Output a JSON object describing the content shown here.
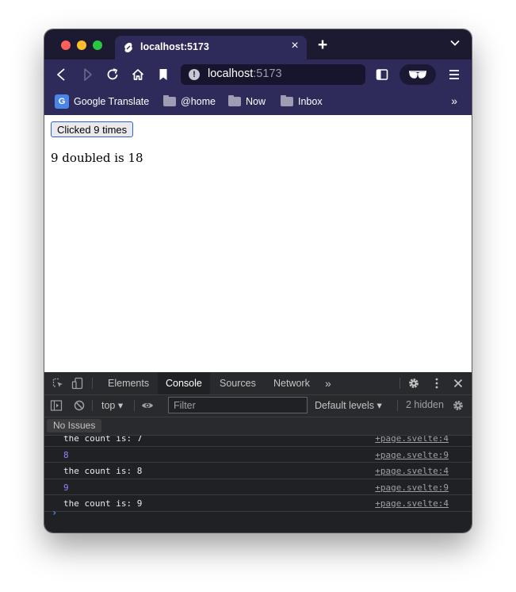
{
  "browser": {
    "tab_title": "localhost:5173",
    "url_host": "localhost",
    "url_port": ":5173",
    "new_tab_label": "+",
    "tab_close_label": "×"
  },
  "bookmarks": [
    {
      "label": "Google Translate",
      "icon": "google-translate-icon"
    },
    {
      "label": "@home",
      "icon": "folder-icon"
    },
    {
      "label": "Now",
      "icon": "folder-icon"
    },
    {
      "label": "Inbox",
      "icon": "folder-icon"
    }
  ],
  "bookmarks_more": "»",
  "page": {
    "button_label": "Clicked 9 times",
    "text": "9 doubled is 18"
  },
  "devtools": {
    "tabs": [
      "Elements",
      "Console",
      "Sources",
      "Network"
    ],
    "active_tab": "Console",
    "more_tabs": "»",
    "context": "top",
    "filter_placeholder": "Filter",
    "levels": "Default levels",
    "hidden_count": "2 hidden",
    "issues_label": "No Issues",
    "console_rows": [
      {
        "message": "the count is: 7",
        "source": "+page.svelte:4",
        "kind": "text"
      },
      {
        "message": "8",
        "source": "+page.svelte:9",
        "kind": "number"
      },
      {
        "message": "the count is: 8",
        "source": "+page.svelte:4",
        "kind": "text"
      },
      {
        "message": "9",
        "source": "+page.svelte:9",
        "kind": "number"
      },
      {
        "message": "the count is: 9",
        "source": "+page.svelte:4",
        "kind": "text"
      }
    ],
    "prompt": "›"
  },
  "colors": {
    "tabstrip": "#1b1a30",
    "toolbar": "#2e2a5a",
    "devtools_bg": "#202124",
    "number_log": "#9980ff",
    "button_border": "#2d65c8"
  }
}
